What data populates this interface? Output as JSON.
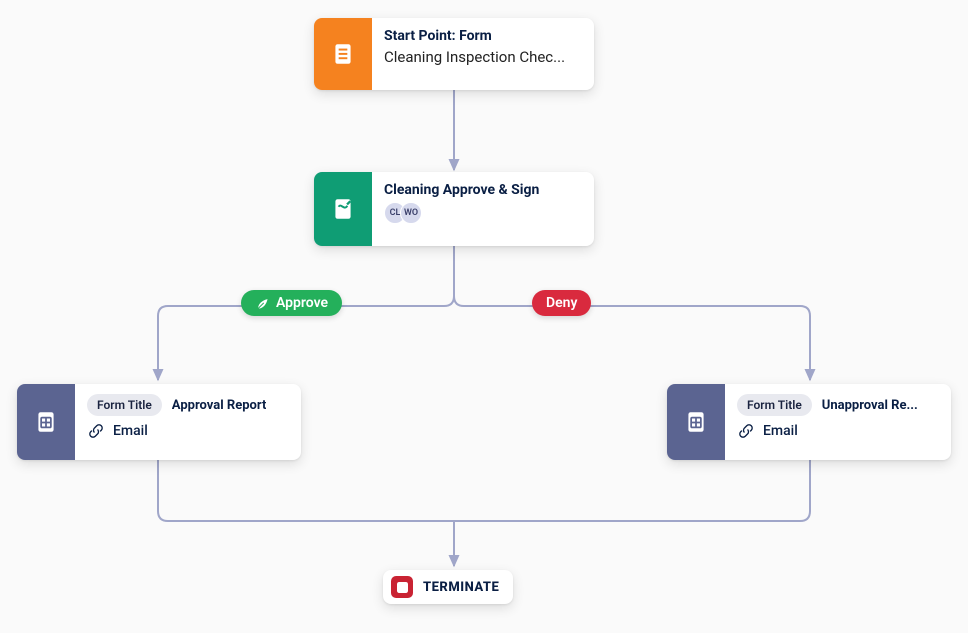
{
  "colors": {
    "orange": "#f5821f",
    "green": "#0f9d74",
    "slate": "#5b6491",
    "line": "#a0a6c9",
    "approve": "#24b05b",
    "deny": "#d92a3e",
    "terminate": "#c92333"
  },
  "nodes": {
    "start": {
      "title": "Start Point: Form",
      "subtitle": "Cleaning Inspection Chec..."
    },
    "approve_sign": {
      "title": "Cleaning Approve & Sign",
      "avatars": [
        "CL",
        "WO"
      ]
    },
    "approval_report": {
      "pill_label": "Form Title",
      "pill_value": "Approval Report",
      "email": "Email"
    },
    "unapproval_report": {
      "pill_label": "Form Title",
      "pill_value": "Unapproval Re...",
      "email": "Email"
    },
    "terminate": {
      "label": "TERMINATE"
    }
  },
  "decisions": {
    "approve": "Approve",
    "deny": "Deny"
  }
}
